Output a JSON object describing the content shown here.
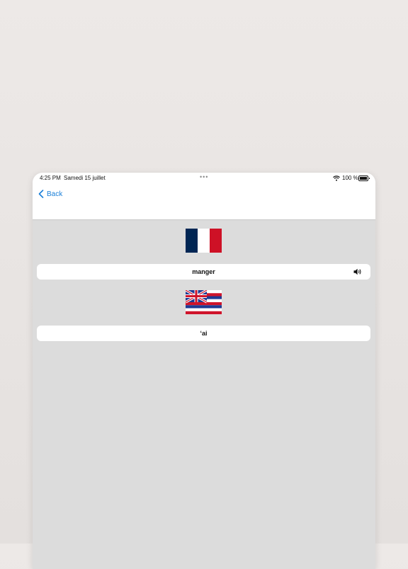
{
  "status_bar": {
    "time": "4:25 PM",
    "date": "Samedi 15 juillet",
    "battery": "100 %"
  },
  "nav": {
    "back_label": "Back"
  },
  "colors": {
    "accent": "#1a7fd8",
    "fr_blue": "#002654",
    "fr_white": "#ffffff",
    "fr_red": "#ce1126",
    "hi_red": "#cf142b",
    "hi_blue": "#1f3a93"
  },
  "source": {
    "flag_icon": "france-flag-icon",
    "word": "manger",
    "audio_icon": "speaker-icon"
  },
  "target": {
    "flag_icon": "hawaii-flag-icon",
    "word": "ʻai"
  }
}
